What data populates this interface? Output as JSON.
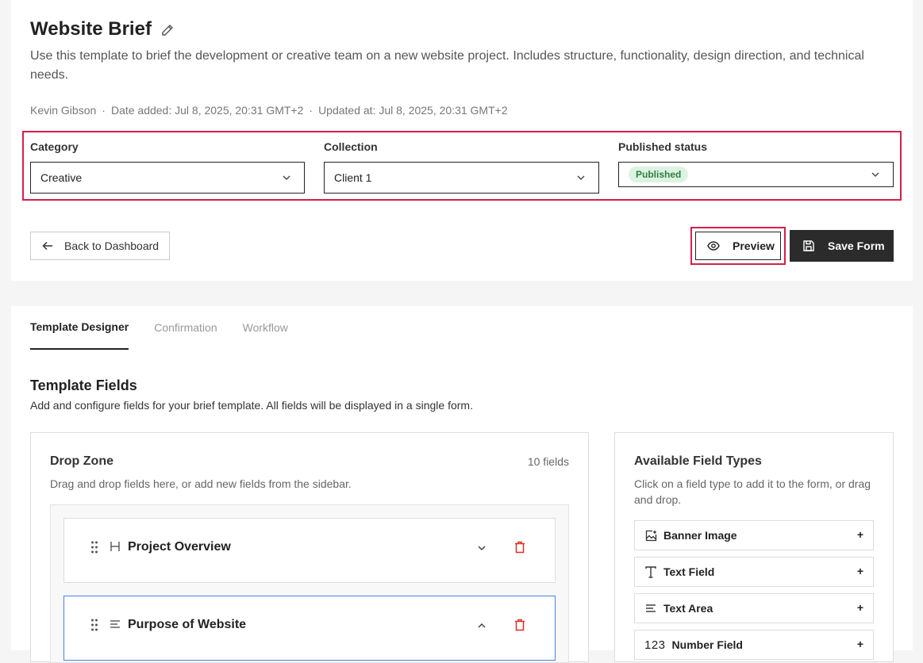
{
  "header": {
    "title": "Website Brief",
    "description": "Use this template to brief the development or creative team on a new website project. Includes structure, functionality, design direction, and technical needs.",
    "author": "Kevin Gibson",
    "separator": "·",
    "date_added": "Date added: Jul 8, 2025, 20:31 GMT+2",
    "updated_at": "Updated at: Jul 8, 2025, 20:31 GMT+2"
  },
  "filters": {
    "category": {
      "label": "Category",
      "value": "Creative"
    },
    "collection": {
      "label": "Collection",
      "value": "Client 1"
    },
    "status": {
      "label": "Published status",
      "value": "Published",
      "color": "#2f7d3f",
      "bg": "#ddf3e2"
    }
  },
  "actions": {
    "back_label": "Back to Dashboard",
    "preview_label": "Preview",
    "save_label": "Save Form",
    "highlight_color": "#d4204b"
  },
  "tabs": [
    {
      "label": "Template Designer",
      "active": true
    },
    {
      "label": "Confirmation",
      "active": false
    },
    {
      "label": "Workflow",
      "active": false
    }
  ],
  "template_fields": {
    "title": "Template Fields",
    "subtitle": "Add and configure fields for your brief template. All fields will be displayed in a single form."
  },
  "drop_zone": {
    "title": "Drop Zone",
    "count": "10 fields",
    "subtitle": "Drag and drop fields here, or add new fields from the sidebar.",
    "fields": [
      {
        "name": "Project Overview",
        "type_icon": "heading-icon",
        "expanded": false
      },
      {
        "name": "Purpose of Website",
        "type_icon": "text-area-icon",
        "expanded": true
      }
    ]
  },
  "field_types": {
    "title": "Available Field Types",
    "subtitle": "Click on a field type to add it to the form, or drag and drop.",
    "items": [
      {
        "label": "Banner Image",
        "icon": "image-icon"
      },
      {
        "label": "Text Field",
        "icon": "text-field-icon"
      },
      {
        "label": "Text Area",
        "icon": "text-area-icon"
      },
      {
        "label": "Number Field",
        "icon": "number-icon",
        "icon_text": "123"
      }
    ],
    "plus": "+"
  }
}
